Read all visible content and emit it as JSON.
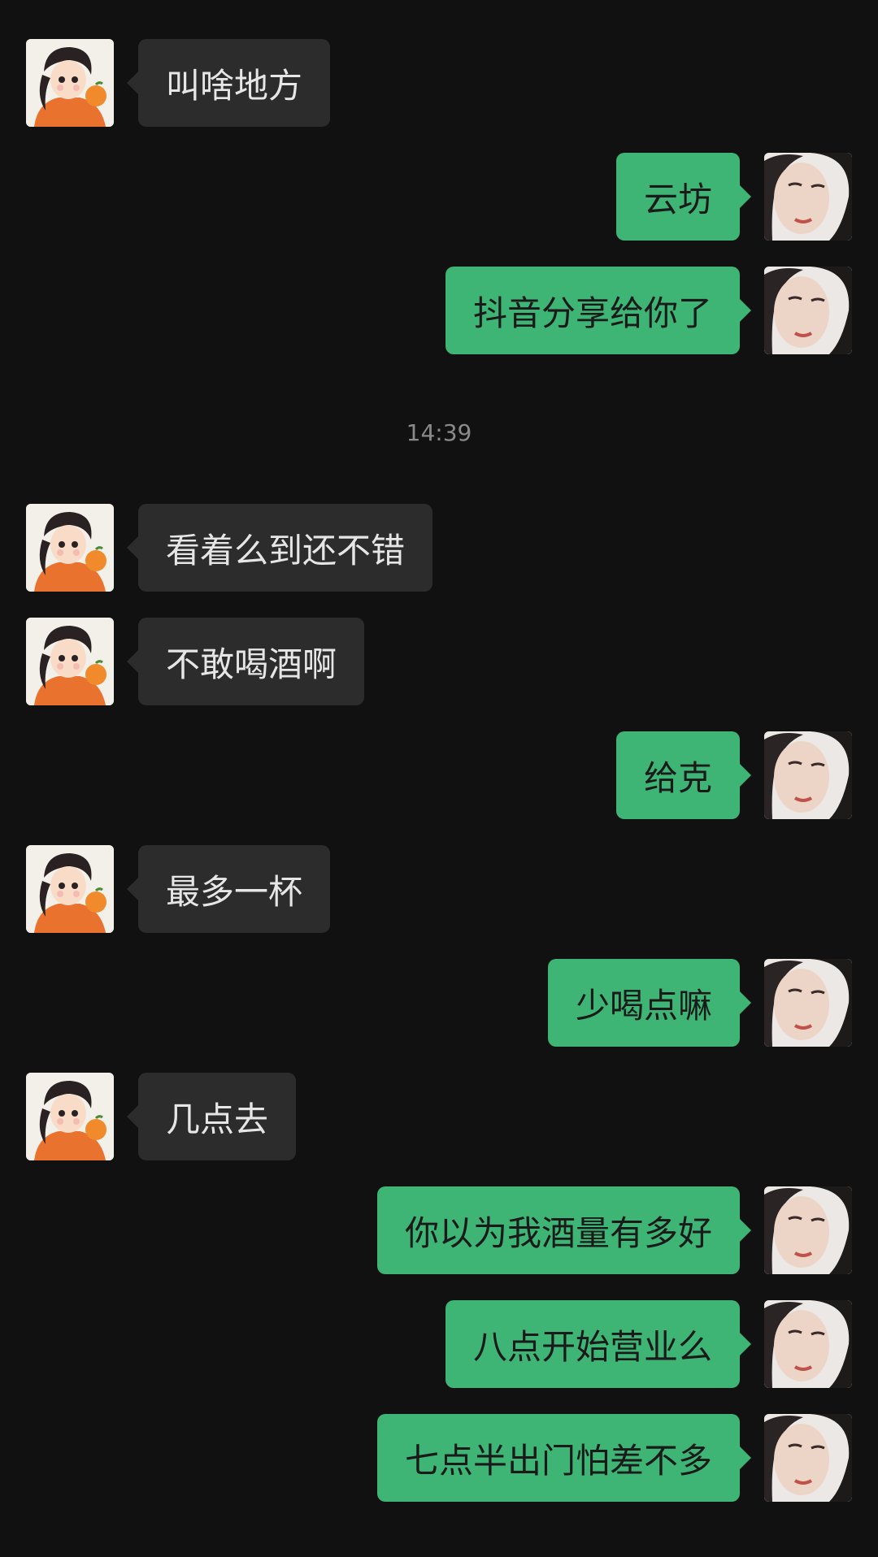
{
  "timestamp": "14:39",
  "messages": [
    {
      "side": "in",
      "text": "叫啥地方"
    },
    {
      "side": "out",
      "text": "云坊"
    },
    {
      "side": "out",
      "text": "抖音分享给你了"
    },
    {
      "side": "in",
      "text": "看着么到还不错"
    },
    {
      "side": "in",
      "text": "不敢喝酒啊"
    },
    {
      "side": "out",
      "text": "给克"
    },
    {
      "side": "in",
      "text": "最多一杯"
    },
    {
      "side": "out",
      "text": "少喝点嘛"
    },
    {
      "side": "in",
      "text": "几点去"
    },
    {
      "side": "out",
      "text": "你以为我酒量有多好"
    },
    {
      "side": "out",
      "text": "八点开始营业么"
    },
    {
      "side": "out",
      "text": "七点半出门怕差不多"
    }
  ],
  "colors": {
    "background": "#111111",
    "incoming_bubble": "#2c2c2c",
    "outgoing_bubble": "#3eb575",
    "timestamp_text": "#8a8a8a"
  },
  "icons": {
    "incoming_avatar": "cartoon-girl-with-orange-avatar",
    "outgoing_avatar": "woman-photo-avatar"
  }
}
